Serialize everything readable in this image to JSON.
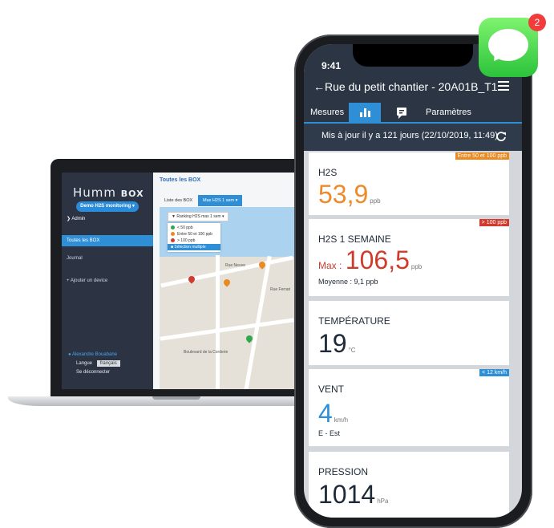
{
  "laptop": {
    "logo_main": "Humm",
    "logo_box": "BOX",
    "demo_button": "Demo H2S monitoring ▾",
    "admin": "❯ Admin",
    "sidebar": [
      {
        "label": "Toutes les BOX",
        "active": true
      },
      {
        "label": "Journal",
        "active": false
      },
      {
        "label": "+   Ajouter un device",
        "active": false
      }
    ],
    "user_name": "Alexandre Bouabane",
    "lang_label": "Langue",
    "lang_value": "français",
    "logout": "Se déconnecter",
    "page_title": "Toutes les BOX",
    "tabs": [
      "Liste des BOX",
      "Max H2S 1 sem ▾"
    ],
    "ranking": "Ranking H2S max 1 sem ▾",
    "legend": [
      {
        "label": "< 50 ppb",
        "color": "#2ea84a"
      },
      {
        "label": "Entre 50 et 100 ppb",
        "color": "#e98a22"
      },
      {
        "label": "> 100 ppb",
        "color": "#d23a2d"
      },
      {
        "label": "Sélection multiple",
        "color": ""
      }
    ],
    "map_labels": [
      "Rue Neuve",
      "Boulevard de la Corderie",
      "Rue Ferrari"
    ]
  },
  "phone": {
    "time": "9:41",
    "title": "Rue du petit chantier - 20A01B_T1...",
    "tabs": [
      "Mesures",
      "",
      "",
      "Paramètres"
    ],
    "updated": "Mis à jour il y a 121 jours (22/10/2019, 11:49)",
    "cards": [
      {
        "title": "H2S",
        "badge": "Entre 50 et 100 ppb",
        "badge_color": "#e98a22",
        "prefix": "",
        "value": "53,9",
        "unit": "ppb",
        "value_color": "#ee8a2a",
        "sub": ""
      },
      {
        "title": "H2S 1 SEMAINE",
        "badge": "> 100 ppb",
        "badge_color": "#d23a2d",
        "prefix": "Max :",
        "value": "106,5",
        "unit": "ppb",
        "value_color": "#d03b2b",
        "sub": "Moyenne : 9,1 ppb"
      },
      {
        "title": "TEMPÉRATURE",
        "badge": "",
        "badge_color": "",
        "prefix": "",
        "value": "19",
        "unit": "°C",
        "value_color": "#1e2a38",
        "sub": ""
      },
      {
        "title": "VENT",
        "badge": "< 12 km/h",
        "badge_color": "#2f8fd6",
        "prefix": "",
        "value": "4",
        "unit": "km/h",
        "value_color": "#2f8fd6",
        "sub": "E - Est"
      },
      {
        "title": "PRESSION",
        "badge": "",
        "badge_color": "",
        "prefix": "",
        "value": "1014",
        "unit": "hPa",
        "value_color": "#1e2a38",
        "sub": ""
      }
    ]
  },
  "notification": {
    "count": "2"
  }
}
